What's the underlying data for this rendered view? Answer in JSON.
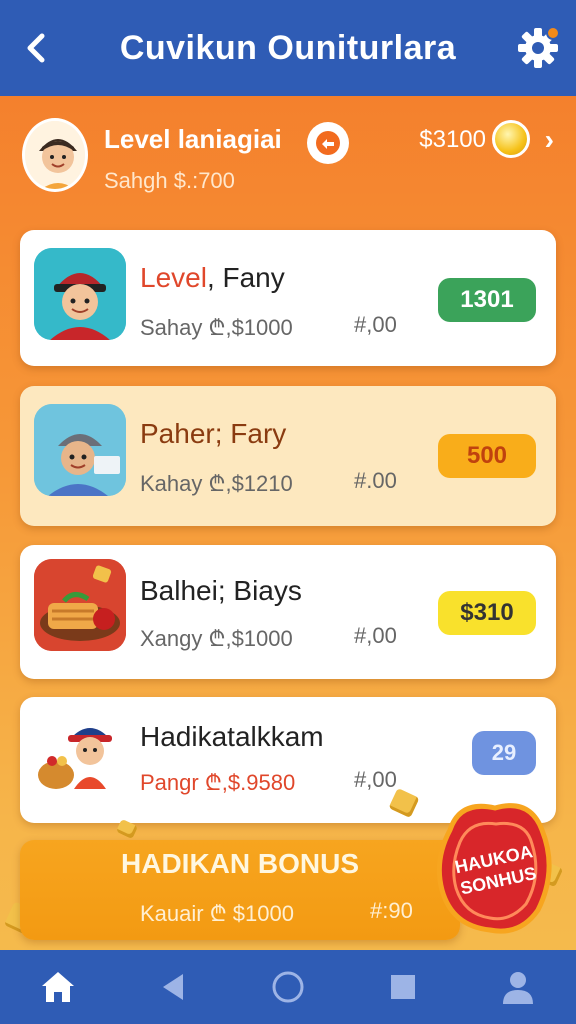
{
  "appbar": {
    "title": "Cuvikun Ouniturlara",
    "back_icon": "back-arrow-icon",
    "settings_icon": "gear-icon"
  },
  "profile": {
    "level_label": "Level laniagiai",
    "subtitle": "Sahgh $.:700",
    "coins": "$3100",
    "coin_icon": "coin-icon"
  },
  "cards": [
    {
      "name_accent": "Level",
      "name_rest": ", Fany",
      "meta": "Sahay ₾,$1000",
      "meta2": "#,00",
      "pill": "1301",
      "pill_color": "#3ba35a"
    },
    {
      "name": "Paher; Fary",
      "meta": "Kahay ₾,$1210",
      "meta2": "#.00",
      "pill": "500",
      "pill_color": "#f9ad1a"
    },
    {
      "name": "Balhei; Biays",
      "meta": "Xangy ₾,$1000",
      "meta2": "#,00",
      "pill": "$310",
      "pill_color": "#f9e12c"
    },
    {
      "name": "Hadikatalkkam",
      "meta": "Pangr ₾,$.9580",
      "meta2": "#,00",
      "pill": "29",
      "pill_color": "#6f93e0"
    }
  ],
  "bonus": {
    "title": "HADIKAN BONUS",
    "sub": "Kauair ₾ $1000",
    "sub2": "#:90",
    "stamp": "HAUKOA SONHUS"
  },
  "nav": {
    "items": [
      "home-icon",
      "back-triangle-icon",
      "circle-home-icon",
      "square-recents-icon",
      "profile-icon"
    ]
  },
  "colors": {
    "appbar": "#2f5cb5",
    "accent_red": "#e0472b",
    "bg_orange": "#f47a2a"
  }
}
